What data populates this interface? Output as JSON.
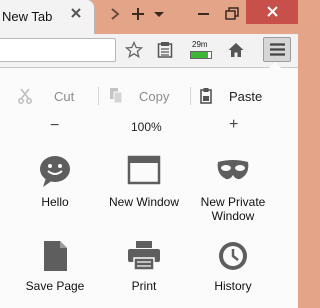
{
  "tab": {
    "title": "New Tab"
  },
  "toolbar": {
    "traffic": {
      "label": "29m",
      "fill_fraction": 0.85
    }
  },
  "edit": {
    "cut": "Cut",
    "copy": "Copy",
    "paste": "Paste"
  },
  "zoom": {
    "decrease": "−",
    "level": "100%",
    "increase": "+"
  },
  "grid": [
    {
      "label": "Hello",
      "icon": "chat-bubble-icon"
    },
    {
      "label": "New Window",
      "icon": "window-icon"
    },
    {
      "label": "New Private\nWindow",
      "icon": "mask-icon"
    },
    {
      "label": "Save Page",
      "icon": "document-icon"
    },
    {
      "label": "Print",
      "icon": "printer-icon"
    },
    {
      "label": "History",
      "icon": "clock-icon"
    }
  ],
  "colors": {
    "title_bar": "#e3a487",
    "close_button": "#c7504a",
    "panel_bg": "#fbfbfb",
    "icon_gray": "#5e5e5e",
    "disabled_text": "#8c8c8c"
  }
}
